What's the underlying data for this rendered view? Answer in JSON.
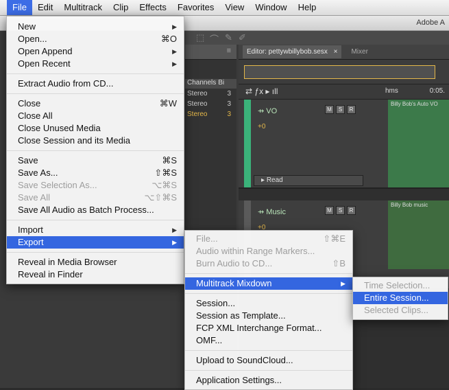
{
  "menubar": {
    "items": [
      "File",
      "Edit",
      "Multitrack",
      "Clip",
      "Effects",
      "Favorites",
      "View",
      "Window",
      "Help"
    ]
  },
  "app": {
    "title": "Adobe A",
    "editor_tab": "Editor: pettywbillybob.sesx",
    "editor_tab_close": "×",
    "mixer_tab": "Mixer",
    "panel_cols": [
      "Channels",
      "Bi"
    ],
    "panel_rows": [
      {
        "ch": "Stereo",
        "bits": "3"
      },
      {
        "ch": "Stereo",
        "bits": "3"
      },
      {
        "ch": "Stereo",
        "bits": "3"
      }
    ],
    "ruler_unit": "hms",
    "ruler_time": "0:05.",
    "tracks": [
      {
        "name": "VO",
        "vol": "+0",
        "clip": "Billy Bob's Auto VO",
        "mode": "Read"
      },
      {
        "name": "Music",
        "vol": "+0",
        "clip": "Billy Bob music"
      }
    ],
    "track_buttons": [
      "M",
      "S",
      "R"
    ]
  },
  "file_menu": {
    "groups": [
      [
        {
          "label": "New",
          "submenu": true
        },
        {
          "label": "Open...",
          "shortcut": "⌘O"
        },
        {
          "label": "Open Append",
          "submenu": true
        },
        {
          "label": "Open Recent",
          "submenu": true
        }
      ],
      [
        {
          "label": "Extract Audio from CD..."
        }
      ],
      [
        {
          "label": "Close",
          "shortcut": "⌘W"
        },
        {
          "label": "Close All"
        },
        {
          "label": "Close Unused Media"
        },
        {
          "label": "Close Session and its Media"
        }
      ],
      [
        {
          "label": "Save",
          "shortcut": "⌘S"
        },
        {
          "label": "Save As...",
          "shortcut": "⇧⌘S"
        },
        {
          "label": "Save Selection As...",
          "shortcut": "⌥⌘S",
          "disabled": true
        },
        {
          "label": "Save All",
          "shortcut": "⌥⇧⌘S",
          "disabled": true
        },
        {
          "label": "Save All Audio as Batch Process..."
        }
      ],
      [
        {
          "label": "Import",
          "submenu": true
        },
        {
          "label": "Export",
          "submenu": true,
          "highlighted": true
        }
      ],
      [
        {
          "label": "Reveal in Media Browser"
        },
        {
          "label": "Reveal in Finder"
        }
      ]
    ]
  },
  "export_menu": {
    "groups": [
      [
        {
          "label": "File...",
          "shortcut": "⇧⌘E",
          "disabled": true
        },
        {
          "label": "Audio within Range Markers...",
          "disabled": true
        },
        {
          "label": "Burn Audio to CD...",
          "shortcut": "⇧B",
          "disabled": true
        }
      ],
      [
        {
          "label": "Multitrack Mixdown",
          "submenu": true,
          "highlighted": true
        }
      ],
      [
        {
          "label": "Session..."
        },
        {
          "label": "Session as Template..."
        },
        {
          "label": "FCP XML Interchange Format..."
        },
        {
          "label": "OMF..."
        }
      ],
      [
        {
          "label": "Upload to SoundCloud..."
        }
      ],
      [
        {
          "label": "Application Settings..."
        }
      ]
    ]
  },
  "mixdown_menu": {
    "items": [
      {
        "label": "Time Selection...",
        "disabled": true
      },
      {
        "label": "Entire Session...",
        "highlighted": true
      },
      {
        "label": "Selected Clips...",
        "disabled": true
      }
    ]
  }
}
